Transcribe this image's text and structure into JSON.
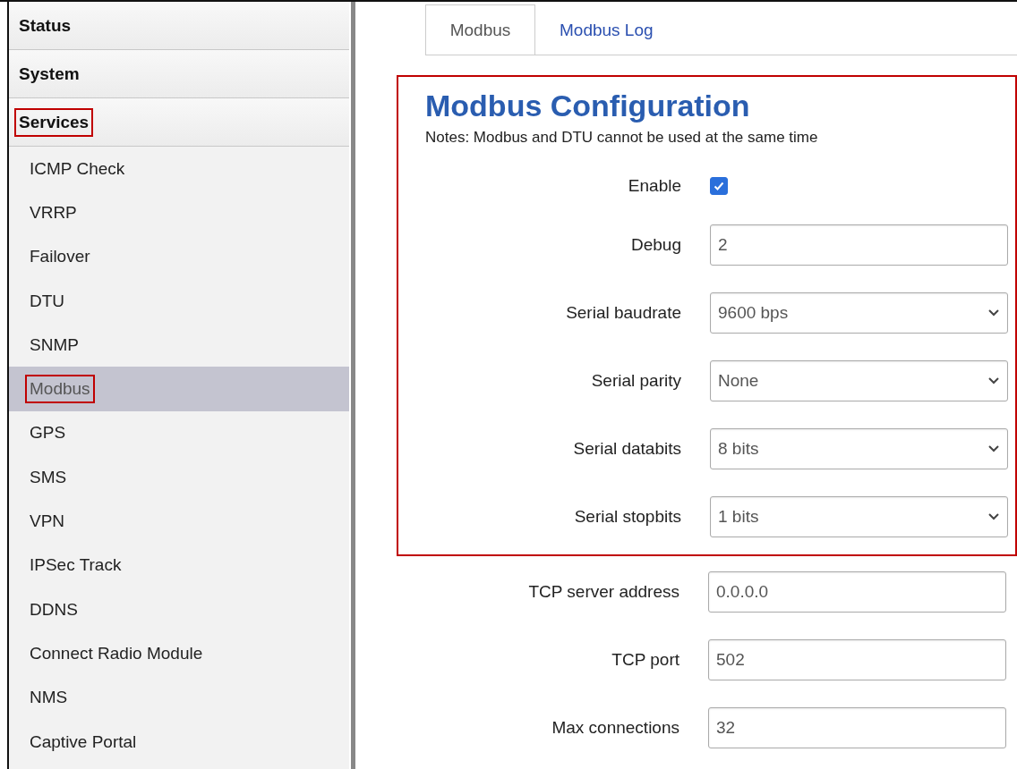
{
  "sidebar": {
    "sections": [
      {
        "label": "Status",
        "highlighted": false
      },
      {
        "label": "System",
        "highlighted": false
      },
      {
        "label": "Services",
        "highlighted": true
      }
    ],
    "items": [
      {
        "label": "ICMP Check",
        "selected": false,
        "highlighted": false
      },
      {
        "label": "VRRP",
        "selected": false,
        "highlighted": false
      },
      {
        "label": "Failover",
        "selected": false,
        "highlighted": false
      },
      {
        "label": "DTU",
        "selected": false,
        "highlighted": false
      },
      {
        "label": "SNMP",
        "selected": false,
        "highlighted": false
      },
      {
        "label": "Modbus",
        "selected": true,
        "highlighted": true
      },
      {
        "label": "GPS",
        "selected": false,
        "highlighted": false
      },
      {
        "label": "SMS",
        "selected": false,
        "highlighted": false
      },
      {
        "label": "VPN",
        "selected": false,
        "highlighted": false
      },
      {
        "label": "IPSec Track",
        "selected": false,
        "highlighted": false
      },
      {
        "label": "DDNS",
        "selected": false,
        "highlighted": false
      },
      {
        "label": "Connect Radio Module",
        "selected": false,
        "highlighted": false
      },
      {
        "label": "NMS",
        "selected": false,
        "highlighted": false
      },
      {
        "label": "Captive Portal",
        "selected": false,
        "highlighted": false
      }
    ]
  },
  "tabs": [
    {
      "label": "Modbus",
      "selected": true
    },
    {
      "label": "Modbus Log",
      "selected": false
    }
  ],
  "section": {
    "title": "Modbus Configuration",
    "note": "Notes: Modbus and DTU cannot be used at the same time",
    "highlighted": true,
    "fields": [
      {
        "label": "Enable",
        "kind": "checkbox",
        "checked": true
      },
      {
        "label": "Debug",
        "kind": "text",
        "value": "2"
      },
      {
        "label": "Serial baudrate",
        "kind": "select",
        "value": "9600 bps"
      },
      {
        "label": "Serial parity",
        "kind": "select",
        "value": "None"
      },
      {
        "label": "Serial databits",
        "kind": "select",
        "value": "8 bits"
      },
      {
        "label": "Serial stopbits",
        "kind": "select",
        "value": "1 bits"
      }
    ]
  },
  "fields": [
    {
      "label": "TCP server address",
      "kind": "text",
      "value": "0.0.0.0"
    },
    {
      "label": "TCP port",
      "kind": "text",
      "value": "502"
    },
    {
      "label": "Max connections",
      "kind": "text",
      "value": "32"
    }
  ]
}
